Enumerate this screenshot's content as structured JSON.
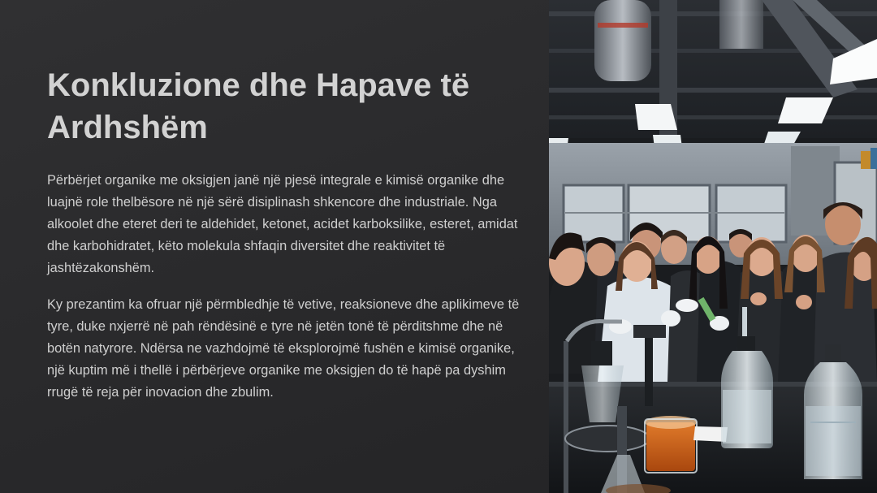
{
  "slide": {
    "title": "Konkluzione dhe Hapave të Ardhshëm",
    "paragraphs": [
      "Përbërjet organike me oksigjen janë një pjesë integrale e kimisë organike dhe luajnë role thelbësore në një sërë disiplinash shkencore dhe industriale. Nga alkoolet dhe eteret deri te aldehidet, ketonet, acidet karboksilike, esteret, amidat dhe karbohidratet, këto molekula shfaqin diversitet dhe reaktivitet të jashtëzakonshëm.",
      "Ky prezantim ka ofruar një përmbledhje të vetive, reaksioneve dhe aplikimeve të tyre, duke nxjerrë në pah rëndësinë e tyre në jetën tonë të përditshme dhe në botën natyrore. Ndërsa ne vazhdojmë të eksplorojmë fushën e kimisë organike, një kuptim më i thellë i përbërjeve organike me oksigjen do të hapë pa dyshim rrugë të reja për inovacion dhe zbulim."
    ]
  },
  "colors": {
    "background": "#2a2a2c",
    "title": "#d2d2d2",
    "body": "#cfcfcf"
  }
}
